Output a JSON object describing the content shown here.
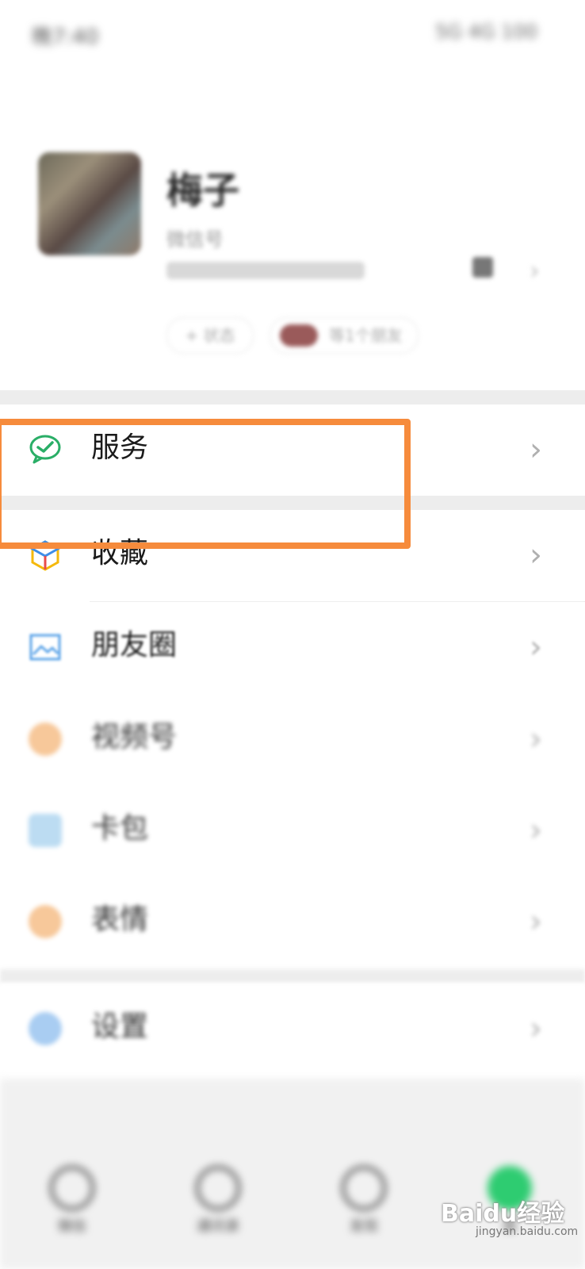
{
  "status_bar": {
    "time": "晚7:40",
    "right_text": "5G 4G 100"
  },
  "profile": {
    "name": "梅子",
    "status_line": "微信号",
    "status_pill": "+ 状态",
    "friends_pill": "等1个朋友"
  },
  "menu": {
    "services": {
      "label": "服务",
      "icon": "wechat-pay-check-icon",
      "color": "#2aae67"
    },
    "favorites": {
      "label": "收藏",
      "icon": "cube-icon"
    },
    "moments": {
      "label": "朋友圈",
      "icon": "image-icon"
    },
    "channels": {
      "label": "视频号",
      "icon": "channels-icon"
    },
    "cards": {
      "label": "卡包",
      "icon": "card-icon"
    },
    "stickers": {
      "label": "表情",
      "icon": "emoji-icon"
    },
    "settings": {
      "label": "设置",
      "icon": "gear-icon"
    }
  },
  "bottom_nav": [
    {
      "label": "微信",
      "icon": "chat-icon"
    },
    {
      "label": "通讯录",
      "icon": "contacts-icon"
    },
    {
      "label": "发现",
      "icon": "compass-icon"
    },
    {
      "label": "我",
      "icon": "me-icon"
    }
  ],
  "highlight_color": "#f68b3c",
  "watermark": {
    "brand": "Baidu经验",
    "domain": "jingyan.baidu.com"
  }
}
